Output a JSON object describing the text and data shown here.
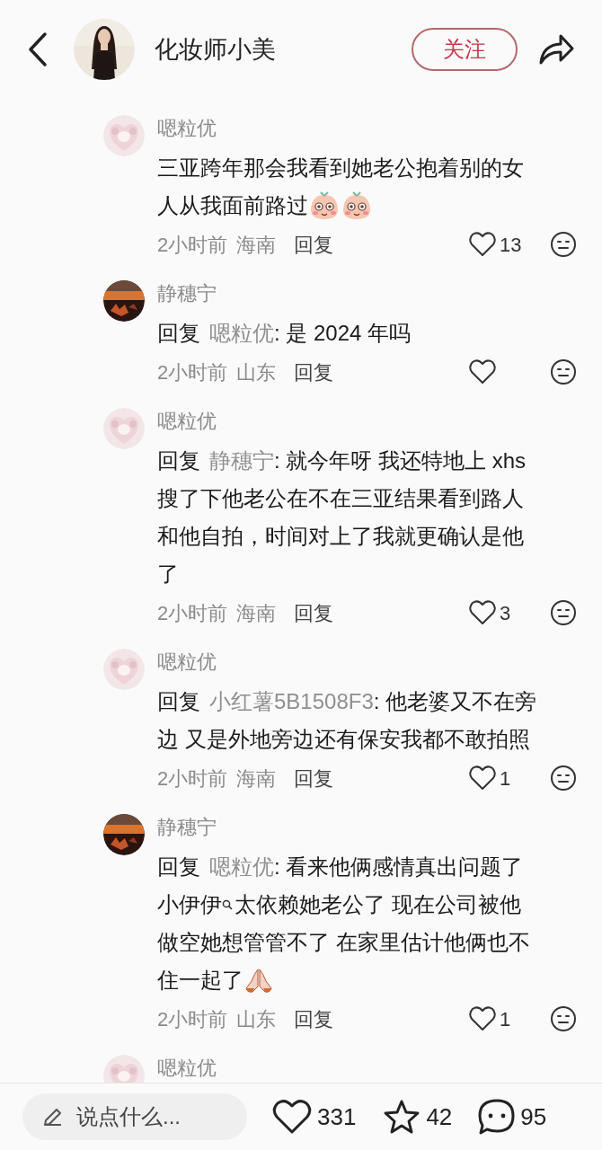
{
  "header": {
    "author_name": "化妆师小美",
    "follow_label": "关注"
  },
  "comments": [
    {
      "author": "嗯粒优",
      "lines": [
        [
          {
            "kind": "text",
            "text": "三亚跨年那会我看到她老公抱着别的女"
          }
        ],
        [
          {
            "kind": "text",
            "text": "人从我面前路过"
          },
          {
            "kind": "emoji_blush"
          },
          {
            "kind": "emoji_blush"
          }
        ]
      ],
      "time": "2小时前",
      "location": "海南",
      "reply_label": "回复",
      "likes": "13"
    },
    {
      "author": "静穗宁",
      "lines": [
        [
          {
            "kind": "reply",
            "text": "回复"
          },
          {
            "kind": "target",
            "text": "嗯粒优"
          },
          {
            "kind": "text",
            "text": ": 是 2024 年吗"
          }
        ]
      ],
      "time": "2小时前",
      "location": "山东",
      "reply_label": "回复"
    },
    {
      "author": "嗯粒优",
      "lines": [
        [
          {
            "kind": "reply",
            "text": "回复"
          },
          {
            "kind": "target",
            "text": "静穗宁"
          },
          {
            "kind": "text",
            "text": ": 就今年呀 我还特地上 xhs"
          }
        ],
        [
          {
            "kind": "text",
            "text": "搜了下他老公在不在三亚结果看到路人"
          }
        ],
        [
          {
            "kind": "text",
            "text": "和他自拍，时间对上了我就更确认是他"
          }
        ],
        [
          {
            "kind": "text",
            "text": "了"
          }
        ]
      ],
      "time": "2小时前",
      "location": "海南",
      "reply_label": "回复",
      "likes": "3"
    },
    {
      "author": "嗯粒优",
      "lines": [
        [
          {
            "kind": "reply",
            "text": "回复"
          },
          {
            "kind": "target",
            "text": "小红薯5B1508F3"
          },
          {
            "kind": "text",
            "text": ": 他老婆又不在旁"
          }
        ],
        [
          {
            "kind": "text",
            "text": "边 又是外地旁边还有保安我都不敢拍照"
          }
        ]
      ],
      "time": "2小时前",
      "location": "海南",
      "reply_label": "回复",
      "likes": "1"
    },
    {
      "author": "静穗宁",
      "lines": [
        [
          {
            "kind": "reply",
            "text": "回复"
          },
          {
            "kind": "target",
            "text": "嗯粒优"
          },
          {
            "kind": "text",
            "text": ": 看来他俩感情真出问题了"
          }
        ],
        [
          {
            "kind": "text",
            "text": "小伊伊"
          },
          {
            "kind": "search_mark"
          },
          {
            "kind": "text",
            "text": "太依赖她老公了 现在公司被他"
          }
        ],
        [
          {
            "kind": "text",
            "text": "做空她想管管不了 在家里估计他俩也不"
          }
        ],
        [
          {
            "kind": "text",
            "text": "住一起了"
          },
          {
            "kind": "emoji_pray"
          }
        ]
      ],
      "time": "2小时前",
      "location": "山东",
      "reply_label": "回复",
      "likes": "1"
    }
  ],
  "partial_comment": {
    "author": "嗯粒优"
  },
  "bottom_bar": {
    "placeholder": "说点什么...",
    "likes": "331",
    "stars": "42",
    "comments": "95"
  }
}
